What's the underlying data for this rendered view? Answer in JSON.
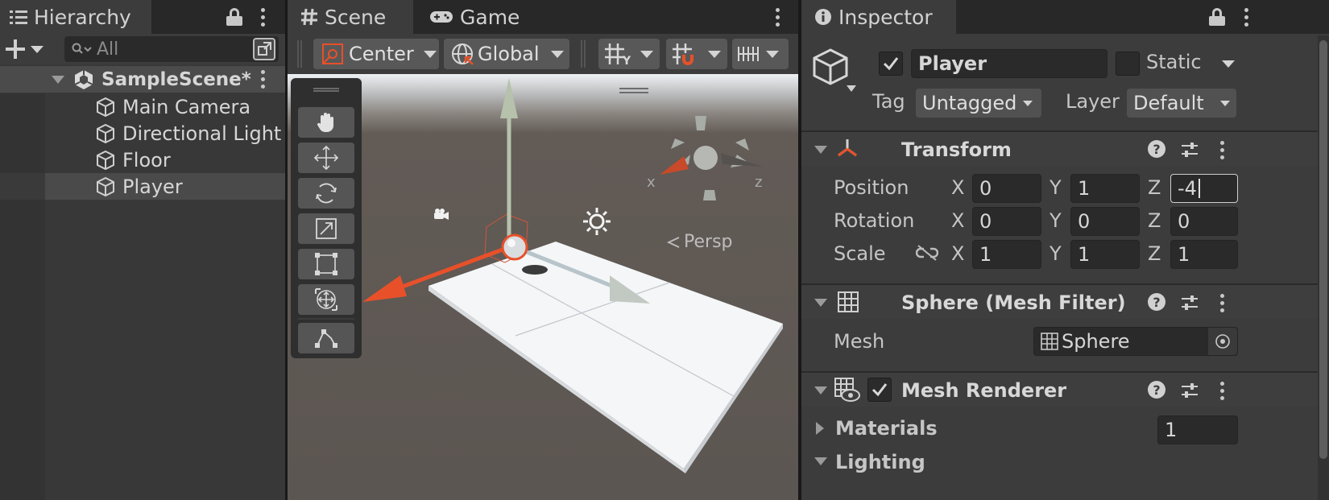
{
  "hierarchy": {
    "tab_label": "Hierarchy",
    "search_placeholder": "All",
    "scene_name": "SampleScene*",
    "items": [
      {
        "label": "Main Camera"
      },
      {
        "label": "Directional Light"
      },
      {
        "label": "Floor"
      },
      {
        "label": "Player",
        "selected": true
      }
    ]
  },
  "scene_view": {
    "tabs": [
      {
        "label": "Scene",
        "active": true
      },
      {
        "label": "Game",
        "active": false
      }
    ],
    "pivot_mode": "Center",
    "pivot_rotation": "Global",
    "gizmo_axis_labels": {
      "x": "x",
      "z": "z"
    },
    "projection_label": "Persp",
    "tools": [
      "hand-tool",
      "move-tool",
      "rotate-tool",
      "scale-tool",
      "rect-tool",
      "transform-tool",
      "custom-editor-tool"
    ]
  },
  "inspector": {
    "tab_label": "Inspector",
    "object_name": "Player",
    "active": true,
    "static_label": "Static",
    "tag_label": "Tag",
    "tag_value": "Untagged",
    "layer_label": "Layer",
    "layer_value": "Default",
    "transform": {
      "title": "Transform",
      "position_label": "Position",
      "rotation_label": "Rotation",
      "scale_label": "Scale",
      "axis_x": "X",
      "axis_y": "Y",
      "axis_z": "Z",
      "position": {
        "x": "0",
        "y": "1",
        "z": "-4"
      },
      "rotation": {
        "x": "0",
        "y": "0",
        "z": "0"
      },
      "scale": {
        "x": "1",
        "y": "1",
        "z": "1"
      }
    },
    "mesh_filter": {
      "title": "Sphere (Mesh Filter)",
      "mesh_label": "Mesh",
      "mesh_value": "Sphere"
    },
    "mesh_renderer": {
      "title": "Mesh Renderer",
      "enabled": true,
      "materials_label": "Materials",
      "materials_count": "1",
      "lighting_label": "Lighting"
    }
  },
  "colors": {
    "x_axis": "#e8502a",
    "y_axis": "#b6c2ab",
    "z_axis": "#b7c4c9",
    "selection": "#4a4a4a"
  }
}
